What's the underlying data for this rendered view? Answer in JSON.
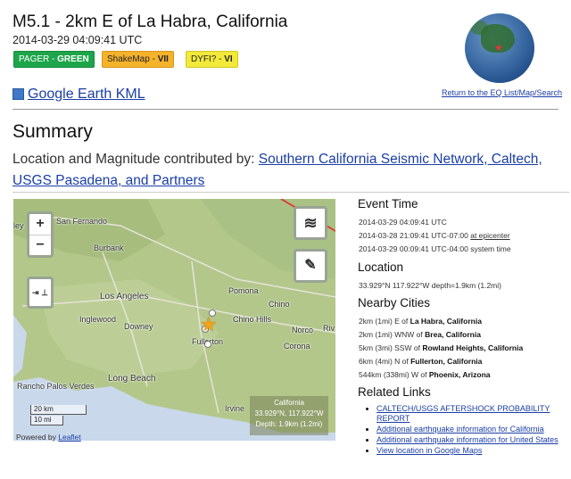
{
  "event": {
    "title": "M5.1 - 2km E of La Habra, California",
    "datetime": "2014-03-29 04:09:41 UTC",
    "badges": {
      "pager_label": "PAGER - ",
      "pager_value": "GREEN",
      "shakemap_label": "ShakeMap - ",
      "shakemap_value": "VII",
      "dyfi_label": "DYFI? - ",
      "dyfi_value": "VI"
    },
    "colors": {
      "pager": "#1ea54a",
      "shakemap": "#f5b32c",
      "dyfi": "#f3e93a",
      "link": "#1a3ea6"
    }
  },
  "kml_link": "Google Earth KML",
  "return_link": "Return to the EQ List/Map/Search",
  "summary": {
    "heading": "Summary",
    "contrib_prefix": "Location and Magnitude contributed by: ",
    "contrib_link": "Southern California Seismic Network, Caltech, USGS Pasadena, and Partners"
  },
  "map": {
    "zoom_in": "+",
    "zoom_out": "−",
    "cities": [
      "San Fernando",
      "Burbank",
      "Los Angeles",
      "Inglewood",
      "Downey",
      "Pomona",
      "Chino",
      "Chino Hills",
      "Norco",
      "Riv",
      "Fullerton",
      "Corona",
      "Long Beach",
      "Rancho Palos Verdes",
      "Irvine",
      "ley"
    ],
    "scale_km": "20 km",
    "scale_mi": "10 mi",
    "powered_prefix": "Powered by ",
    "powered_link": "Leaflet",
    "coord_line1": "California",
    "coord_line2": "33.929°N, 117.922°W",
    "coord_line3": "Depth: 1.9km (1.2mi)"
  },
  "event_time": {
    "heading": "Event Time",
    "utc": "2014-03-29 04:09:41 UTC",
    "epicenter_time": "2014-03-28 21:09:41 UTC-07:00 ",
    "epicenter_link": "at epicenter",
    "system_time": "2014-03-29 00:09:41 UTC-04:00 system time"
  },
  "location": {
    "heading": "Location",
    "value": "33.929°N 117.922°W depth=1.9km (1.2mi)"
  },
  "nearby": {
    "heading": "Nearby Cities",
    "items": [
      {
        "dist": "2km (1mi) E of ",
        "city": "La Habra, California"
      },
      {
        "dist": "2km (1mi) WNW of ",
        "city": "Brea, California"
      },
      {
        "dist": "5km (3mi) SSW of ",
        "city": "Rowland Heights, California"
      },
      {
        "dist": "6km (4mi) N of ",
        "city": "Fullerton, California"
      },
      {
        "dist": "544km (338mi) W of ",
        "city": "Phoenix, Arizona"
      }
    ]
  },
  "related": {
    "heading": "Related Links",
    "items": [
      "CALTECH/USGS AFTERSHOCK PROBABILITY REPORT",
      "Additional earthquake information for California",
      "Additional earthquake information for United States",
      "View location in Google Maps"
    ]
  }
}
